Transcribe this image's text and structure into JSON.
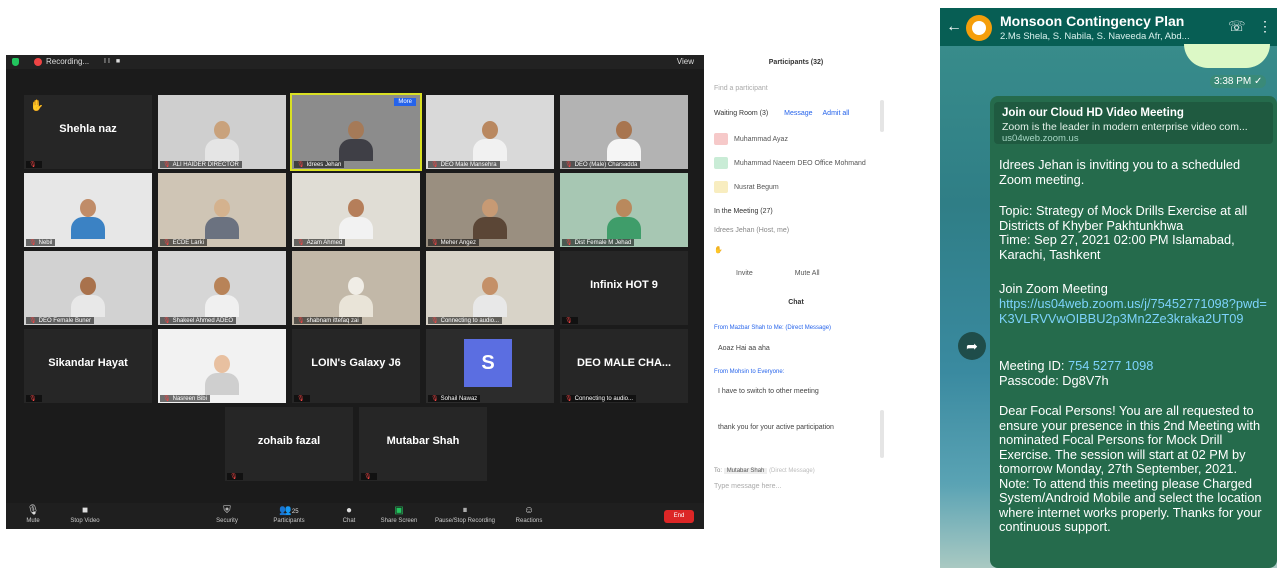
{
  "zoom": {
    "top_bar": {
      "recording": "Recording...",
      "pause_controls": "II ■",
      "view": "View"
    },
    "tiles": [
      {
        "name": "Shehla naz",
        "label": "",
        "kind": "name",
        "hand": true
      },
      {
        "name": "",
        "label": "ALI HAIDER DIRECTOR",
        "kind": "video",
        "skin": "#c9a27c",
        "shirt": "#e5e5e5",
        "bg": "#cfcfcf"
      },
      {
        "name": "",
        "label": "Idrees Jehan",
        "kind": "video",
        "skin": "#a57a58",
        "shirt": "#3f3f46",
        "bg": "#8c8c8c",
        "active": true,
        "chip": "More"
      },
      {
        "name": "",
        "label": "DEO Male Mansehra",
        "kind": "video",
        "skin": "#b98860",
        "shirt": "#f1f1f1",
        "bg": "#d9d9d9"
      },
      {
        "name": "",
        "label": "DEO (Male) Charsadda",
        "kind": "video",
        "skin": "#a8754f",
        "shirt": "#f5f5f5",
        "bg": "#b3b3b3"
      },
      {
        "name": "",
        "label": "Nebil",
        "kind": "video",
        "skin": "#c08c68",
        "shirt": "#3b82c4",
        "bg": "#e7e7e7"
      },
      {
        "name": "",
        "label": "ECDE Larki",
        "kind": "video",
        "skin": "#d4b28e",
        "shirt": "#6b7280",
        "bg": "#cfc5b5"
      },
      {
        "name": "",
        "label": "Azam Ahmed",
        "kind": "video",
        "skin": "#b57e5a",
        "shirt": "#f2f2f2",
        "bg": "#e0ddd5"
      },
      {
        "name": "",
        "label": "Meher Angez",
        "kind": "video",
        "skin": "#c79a74",
        "shirt": "#5b4636",
        "bg": "#9a8f80"
      },
      {
        "name": "",
        "label": "Dist Female M Jehad",
        "kind": "video",
        "skin": "#b9895d",
        "shirt": "#3f9d6a",
        "bg": "#a7c7b3"
      },
      {
        "name": "",
        "label": "DEO Female Buner",
        "kind": "video",
        "skin": "#a9724c",
        "shirt": "#e8e8e8",
        "bg": "#d2d2d2"
      },
      {
        "name": "",
        "label": "Shakeel Ahmed ADEO",
        "kind": "video",
        "skin": "#b88358",
        "shirt": "#f0f0f0",
        "bg": "#d6d6d6"
      },
      {
        "name": "",
        "label": "shabnam ittefaq zai",
        "kind": "video",
        "skin": "#f0ede6",
        "shirt": "#e9e4d8",
        "bg": "#c2b8a8"
      },
      {
        "name": "",
        "label": "Connecting to audio...",
        "kind": "video",
        "skin": "#c49068",
        "shirt": "#e8e8e8",
        "bg": "#d8d3c8"
      },
      {
        "name": "Infinix HOT 9",
        "label": "",
        "kind": "name"
      },
      {
        "name": "Sikandar Hayat",
        "label": "",
        "kind": "name"
      },
      {
        "name": "",
        "label": "Nasreen Bibi",
        "kind": "video",
        "skin": "#e8c0a0",
        "shirt": "#cfcfcf",
        "bg": "#f2f2f2"
      },
      {
        "name": "LOIN's Galaxy J6",
        "label": "",
        "kind": "name"
      },
      {
        "name": "",
        "label": "Sohail Nawaz",
        "kind": "avatar",
        "avatar_letter": "S"
      },
      {
        "name": "DEO MALE CHA...",
        "label": "Connecting to audio...",
        "kind": "name"
      },
      {
        "name": "zohaib fazal",
        "label": "",
        "kind": "name"
      },
      {
        "name": "Mutabar Shah",
        "label": "",
        "kind": "name"
      }
    ],
    "toolbar": {
      "mute": "Mute",
      "stop_video": "Stop Video",
      "security": "Security",
      "participants": "Participants",
      "participants_count": "25",
      "chat": "Chat",
      "share_screen": "Share Screen",
      "pause_recording": "Pause/Stop Recording",
      "reactions": "Reactions",
      "end": "End"
    }
  },
  "panel": {
    "participants_title": "Participants (32)",
    "search_placeholder": "Find a participant",
    "waiting_room": "Waiting Room (3)",
    "message": "Message",
    "admit_all": "Admit all",
    "waiting": [
      {
        "name": "Muhammad Ayaz",
        "color": "#f6c9c9"
      },
      {
        "name": "Muhammad Naeem DEO Office Mohmand",
        "color": "#c9ecd6"
      },
      {
        "name": "Nusrat Begum",
        "color": "#f8edc0"
      }
    ],
    "in_meeting": "In the Meeting (27)",
    "in_meeting_first": "Idrees Jehan (Host, me)",
    "invite": "Invite",
    "mute_all": "Mute All",
    "chat_title": "Chat",
    "chat": [
      {
        "from": "From Mazbar Shah to Me: (Direct Message)",
        "text": "Aoaz Hai aa aha"
      },
      {
        "from": "From Mohsin to Everyone:",
        "text": "I have to switch to other meeting"
      },
      {
        "from": "",
        "text": "thank you for your active participation"
      }
    ],
    "to_label": "To:",
    "to_value": "Mutabar Shah",
    "direct_note": "(Direct Message)",
    "type_placeholder": "Type message here..."
  },
  "whatsapp": {
    "title": "Monsoon Contingency Plan",
    "members": "2.Ms Shela, S. Nabila, S. Naveeda Afr, Abd...",
    "top_time": "3:38 PM ✓",
    "preview": {
      "title": "Join our Cloud HD Video Meeting",
      "desc": "Zoom is the leader in modern enterprise video com...",
      "url": "us04web.zoom.us"
    },
    "message": {
      "invite": "Idrees Jehan is inviting you to a scheduled Zoom meeting.",
      "topic": "Topic: Strategy of Mock Drills  Exercise at all Districts of Khyber Pakhtunkhwa\nTime: Sep 27, 2021 02:00 PM Islamabad, Karachi, Tashkent",
      "join_label": "Join Zoom Meeting",
      "join_link": "https://us04web.zoom.us/j/75452771098?pwd=K3VLRVVwOIBBU2p3Mn2Ze3kraka2UT09",
      "meeting_id_label": "Meeting ID: ",
      "meeting_id": "754 5277 1098",
      "passcode": "Passcode: Dg8V7h",
      "body": "Dear Focal Persons! You are all requested to ensure your presence in this 2nd Meeting with nominated Focal Persons for Mock Drill Exercise. The session will start at 02 PM by tomorrow Monday, 27th September, 2021.\n Note: To attend this meeting please Charged System/Android Mobile and select the location where internet works properly. Thanks for your continuous support."
    }
  }
}
